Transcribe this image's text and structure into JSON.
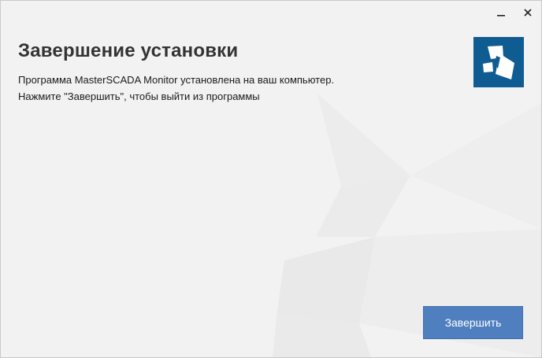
{
  "window": {
    "controls": {
      "minimize_icon": "minimize-icon",
      "close_icon": "close-icon"
    }
  },
  "main": {
    "title": "Завершение установки",
    "lines": [
      "Программа MasterSCADA Monitor установлена на ваш компьютер.",
      "Нажмите \"Завершить\", чтобы выйти из программы"
    ],
    "logo_icon": "masterscada-logo-icon"
  },
  "footer": {
    "finish_label": "Завершить"
  },
  "colors": {
    "background": "#f2f2f2",
    "accent_button": "#4f7fbf",
    "logo_bg": "#0f5c92",
    "title_text": "#333333"
  }
}
